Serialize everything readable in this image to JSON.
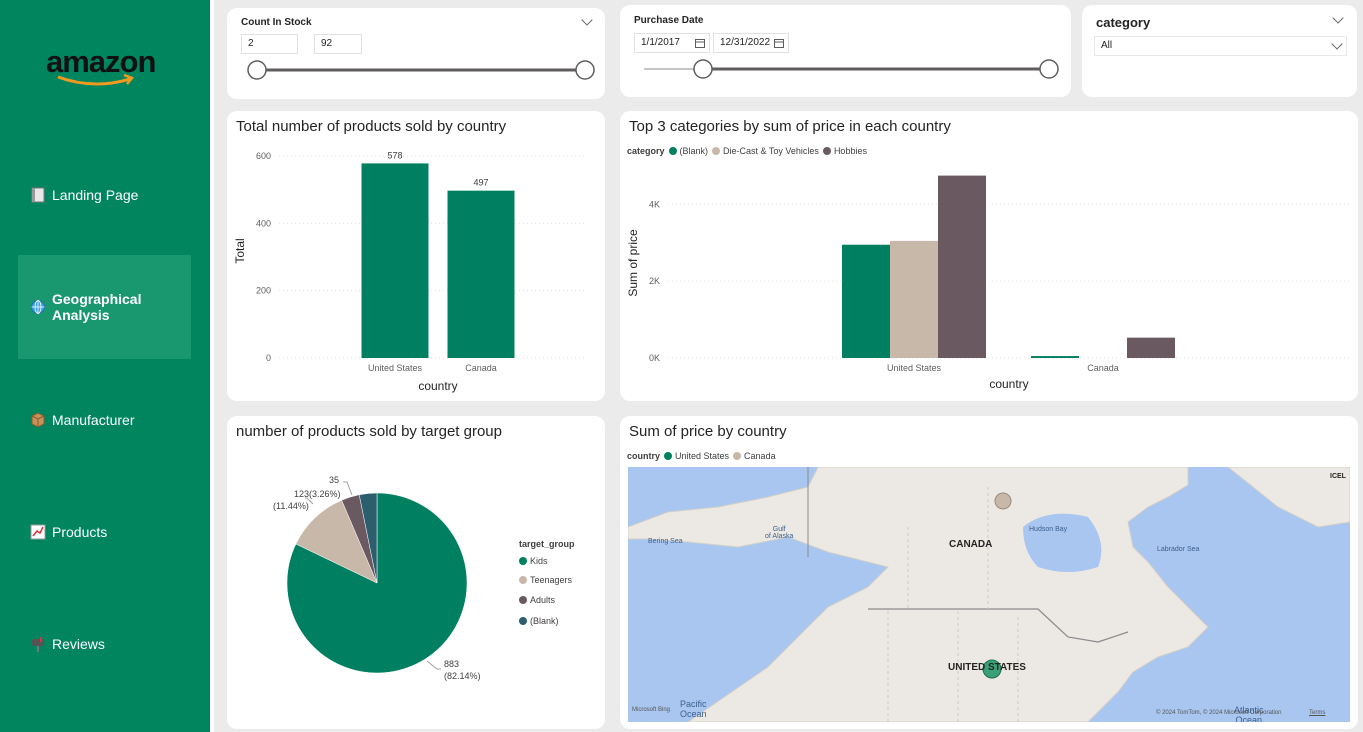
{
  "brand": {
    "logo_text": "amazon"
  },
  "nav": {
    "items": [
      {
        "label": "Landing Page",
        "icon": "book-icon",
        "active": false
      },
      {
        "label": "Geographical Analysis",
        "icon": "globe-icon",
        "active": true
      },
      {
        "label": "Manufacturer",
        "icon": "box-icon",
        "active": false
      },
      {
        "label": "Products",
        "icon": "chart-icon",
        "active": false
      },
      {
        "label": "Reviews",
        "icon": "mailbox-icon",
        "active": false
      }
    ]
  },
  "slicers": {
    "stock": {
      "title": "Count In Stock",
      "min": "2",
      "max": "92"
    },
    "date": {
      "title": "Purchase Date",
      "start": "1/1/2017",
      "end": "12/31/2022"
    },
    "category": {
      "title": "category",
      "value": "All"
    }
  },
  "colors": {
    "kids": "#008060",
    "teen": "#c8b8aa",
    "adults": "#6b5961",
    "blank": "#2b5f6e"
  },
  "charts": {
    "country_total": {
      "title": "Total number of products sold by country",
      "chart_data": {
        "type": "bar",
        "categories": [
          "United States",
          "Canada"
        ],
        "values": [
          578,
          497
        ],
        "xlabel": "country",
        "ylabel": "Total",
        "ylim": [
          0,
          600
        ],
        "yticks": [
          "0",
          "200",
          "400",
          "600"
        ],
        "data_labels": [
          "578",
          "497"
        ]
      }
    },
    "top3": {
      "title": "Top 3 categories by sum of price in each country",
      "legend_title": "category",
      "chart_data": {
        "type": "bar",
        "categories": [
          "United States",
          "Canada"
        ],
        "series": [
          {
            "name": "(Blank)",
            "values": [
              2950,
              50
            ]
          },
          {
            "name": "Die-Cast & Toy Vehicles",
            "values": [
              3050,
              0
            ]
          },
          {
            "name": "Hobbies",
            "values": [
              4750,
              530
            ]
          }
        ],
        "xlabel": "country",
        "ylabel": "Sum of price",
        "ylim": [
          0,
          5000
        ],
        "yticks": [
          "0K",
          "2K",
          "4K"
        ]
      }
    },
    "target_group": {
      "title": "number of products sold by target group",
      "legend_title": "target_group",
      "chart_data": {
        "type": "pie",
        "categories": [
          "Kids",
          "Teenagers",
          "Adults",
          "(Blank)"
        ],
        "values": [
          883,
          123,
          35,
          34
        ],
        "labels": [
          {
            "value": "883",
            "pct": "(82.14%)"
          },
          {
            "value": "123",
            "pct": "(11.44%)"
          },
          {
            "value": "35",
            "pct": "(3.26%)"
          }
        ]
      }
    },
    "map": {
      "title": "Sum of price by country",
      "legend_title": "country",
      "legend": [
        "United States",
        "Canada"
      ],
      "labels": {
        "canada": "CANADA",
        "usa": "UNITED STATES",
        "bering": "Bering Sea",
        "gulf": "Gulf\nof Alaska",
        "hudson": "Hudson Bay",
        "labrador": "Labrador Sea",
        "pacific": "Pacific\nOcean",
        "atlantic": "Atlantic\nOcean",
        "icel": "ICEL",
        "bing": "Microsoft Bing",
        "copyright": "© 2024 TomTom, © 2024 Microsoft Corporation",
        "terms": "Terms"
      }
    }
  }
}
